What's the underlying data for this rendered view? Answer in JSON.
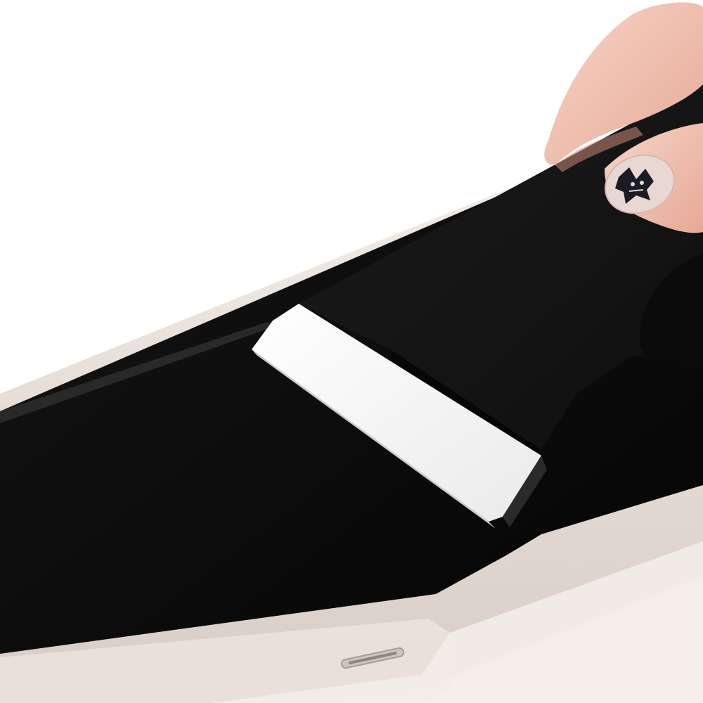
{
  "scene": {
    "description_free": true,
    "colors": {
      "background": "#ffffff",
      "phone_frame": "#e9e2dc",
      "phone_frame_edge": "#c9bfb8",
      "screen": "#0b0b0b",
      "protector_film": "#141414",
      "card_white": "#f7f7f7",
      "card_edge": "#d9d9d9",
      "skin": "#f2c7b8",
      "skin_shadow": "#d89a88",
      "nail_base": "#e8d6d2",
      "nail_art": "#1b1b24"
    },
    "icons": [
      "phone-icon",
      "squeegee-card-icon",
      "screen-protector-icon",
      "hand-icon",
      "speaker-grille-icon"
    ]
  }
}
